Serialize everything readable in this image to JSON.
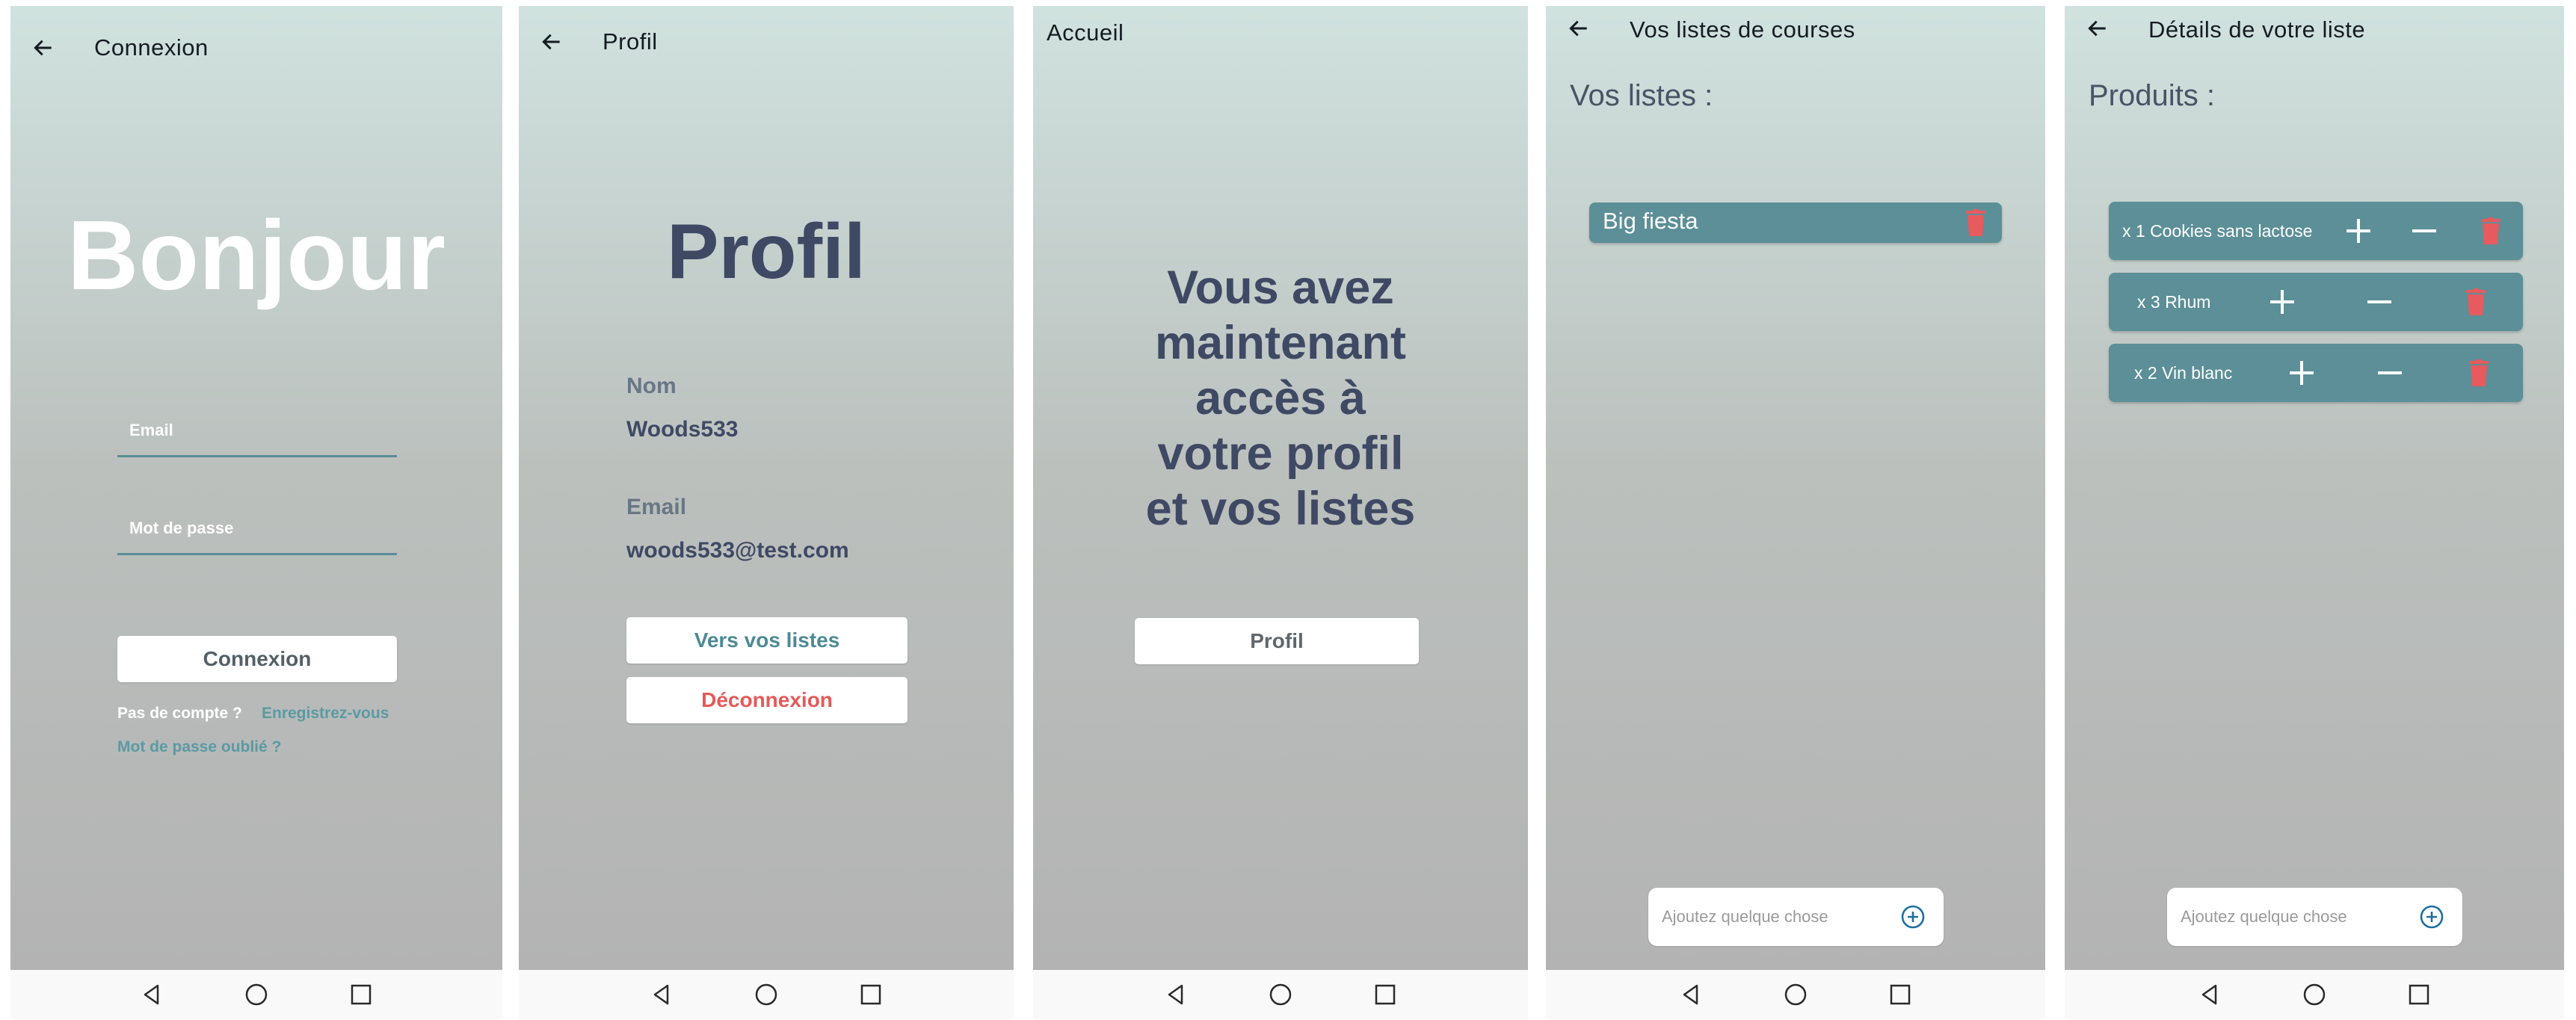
{
  "screens": {
    "login": {
      "title": "Connexion",
      "heading": "Bonjour",
      "email_label": "Email",
      "password_label": "Mot de passe",
      "submit_label": "Connexion",
      "no_account": "Pas de compte ?",
      "register_link": "Enregistrez-vous",
      "forgot_link": "Mot de passe oublié ?"
    },
    "profile": {
      "title": "Profil",
      "heading": "Profil",
      "name_label": "Nom",
      "name_value": "Woods533",
      "email_label": "Email",
      "email_value": "woods533@test.com",
      "lists_button": "Vers vos listes",
      "logout_button": "Déconnexion"
    },
    "home": {
      "title": "Accueil",
      "message_lines": [
        "Vous avez",
        "maintenant",
        "accès à",
        "votre profil",
        "et vos listes"
      ],
      "profile_button": "Profil"
    },
    "lists": {
      "title": "Vos listes de courses",
      "section_title": "Vos listes :",
      "items": [
        {
          "name": "Big fiesta"
        }
      ],
      "add_placeholder": "Ajoutez quelque chose"
    },
    "details": {
      "title": "Détails de votre liste",
      "section_title": "Produits :",
      "products": [
        {
          "label": "x 1 Cookies sans lactose"
        },
        {
          "label": "x 3 Rhum"
        },
        {
          "label": "x 2 Vin blanc"
        }
      ],
      "add_placeholder": "Ajoutez quelque chose"
    }
  },
  "icons": {
    "back": "arrow-left-icon",
    "trash": "trash-icon",
    "plus": "plus-icon",
    "minus": "minus-icon",
    "add": "add-circle-icon",
    "nav_back": "triangle-back-icon",
    "nav_home": "circle-home-icon",
    "nav_recent": "square-recent-icon"
  },
  "colors": {
    "gradient_top": "#d0e2df",
    "gradient_bottom": "#b3b3b3",
    "teal": "#5c8f97",
    "link_teal": "#5b9aa3",
    "dark_slate": "#3f4964",
    "danger": "#e45a58",
    "trash_red": "#e75a5d",
    "add_blue": "#1f6f9f"
  }
}
